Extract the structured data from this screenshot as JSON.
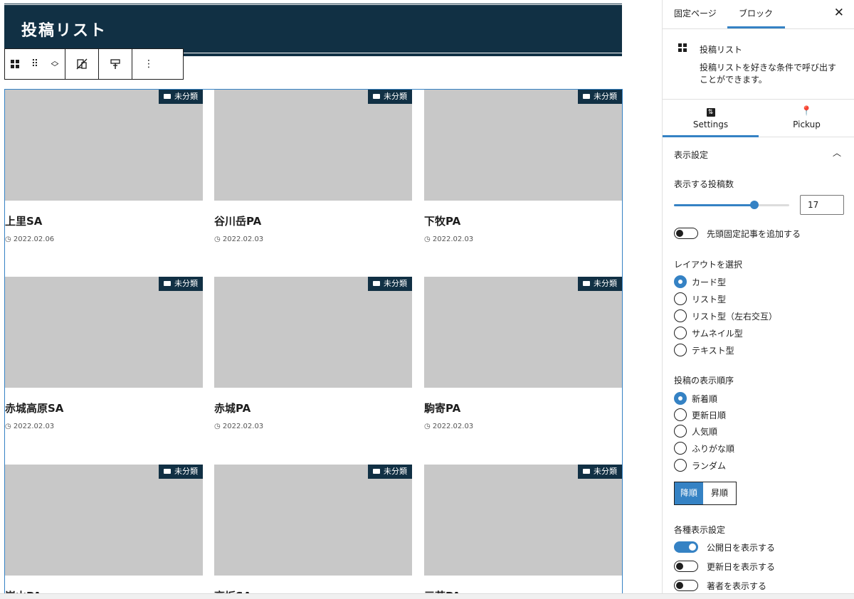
{
  "editor": {
    "heading": "投稿リスト",
    "posts": [
      {
        "category": "未分類",
        "title": "上里SA",
        "date": "2022.02.06"
      },
      {
        "category": "未分類",
        "title": "谷川岳PA",
        "date": "2022.02.03"
      },
      {
        "category": "未分類",
        "title": "下牧PA",
        "date": "2022.02.03"
      },
      {
        "category": "未分類",
        "title": "赤城高原SA",
        "date": "2022.02.03"
      },
      {
        "category": "未分類",
        "title": "赤城PA",
        "date": "2022.02.03"
      },
      {
        "category": "未分類",
        "title": "駒寄PA",
        "date": "2022.02.03"
      },
      {
        "category": "未分類",
        "title": "嵐山PA",
        "date": ""
      },
      {
        "category": "未分類",
        "title": "高坂SA",
        "date": ""
      },
      {
        "category": "未分類",
        "title": "三芳PA",
        "date": ""
      }
    ]
  },
  "sidebar": {
    "tabs": [
      "固定ページ",
      "ブロック"
    ],
    "active_tab": "ブロック",
    "close_icon": "close-icon",
    "block": {
      "title": "投稿リスト",
      "description": "投稿リストを好きな条件で呼び出すことができます。",
      "icon": "grid-icon"
    },
    "panel_tabs": [
      {
        "label": "Settings",
        "icon": "settings-icon"
      },
      {
        "label": "Pickup",
        "icon": "pin-icon"
      }
    ],
    "display_section": {
      "title": "表示設定",
      "post_count_label": "表示する投稿数",
      "post_count": "17",
      "post_count_fraction": 0.7,
      "sticky_toggle": {
        "label": "先頭固定記事を追加する",
        "on": false
      },
      "layout_label": "レイアウトを選択",
      "layouts": [
        "カード型",
        "リスト型",
        "リスト型（左右交互）",
        "サムネイル型",
        "テキスト型"
      ],
      "layout_selected": 0,
      "order_label": "投稿の表示順序",
      "orders": [
        "新着順",
        "更新日順",
        "人気順",
        "ふりがな順",
        "ランダム"
      ],
      "order_selected": 0,
      "direction": {
        "desc": "降順",
        "asc": "昇順",
        "selected": "desc"
      },
      "misc_label": "各種表示設定",
      "misc_toggles": [
        {
          "label": "公開日を表示する",
          "on": true
        },
        {
          "label": "更新日を表示する",
          "on": false
        },
        {
          "label": "著者を表示する",
          "on": false
        }
      ]
    }
  },
  "colors": {
    "accent": "#3582c4",
    "heading_bg": "#113044",
    "thumb": "#c8c8c8"
  }
}
